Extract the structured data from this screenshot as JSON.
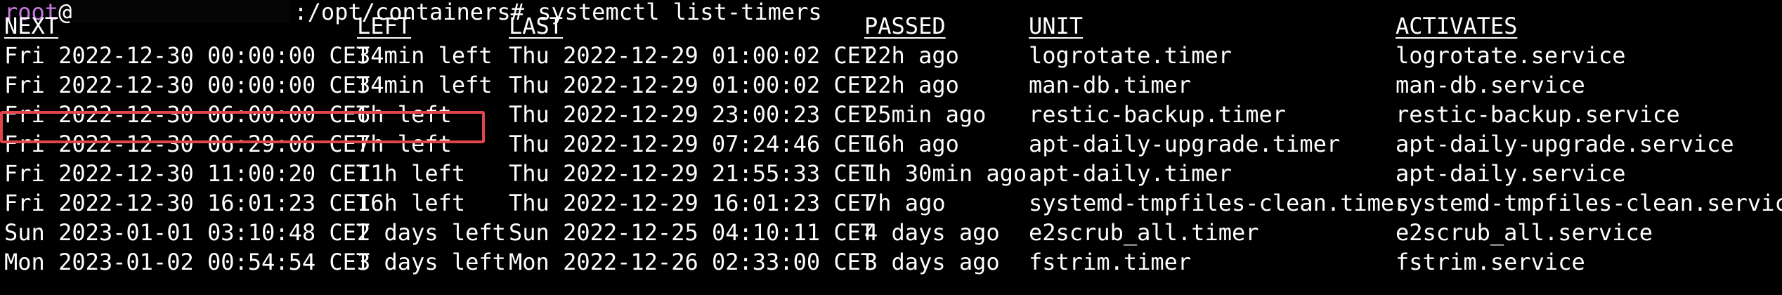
{
  "terminal": {
    "prompt": {
      "user": "root",
      "at": "@",
      "path_and_cmd": ":/opt/containers# systemctl list-timers"
    },
    "headers": {
      "next": "NEXT",
      "left": "LEFT",
      "last": "LAST",
      "passed": "PASSED",
      "unit": "UNIT",
      "activates": "ACTIVATES"
    },
    "rows": [
      {
        "next": "Fri 2022-12-30 00:00:00 CET",
        "left": "34min left",
        "last": "Thu 2022-12-29 01:00:02 CET",
        "passed": "22h ago",
        "unit": "logrotate.timer",
        "activates": "logrotate.service"
      },
      {
        "next": "Fri 2022-12-30 00:00:00 CET",
        "left": "34min left",
        "last": "Thu 2022-12-29 01:00:02 CET",
        "passed": "22h ago",
        "unit": "man-db.timer",
        "activates": "man-db.service"
      },
      {
        "next": "Fri 2022-12-30 06:00:00 CET",
        "left": "6h left",
        "last": "Thu 2022-12-29 23:00:23 CET",
        "passed": "25min ago",
        "unit": "restic-backup.timer",
        "activates": "restic-backup.service"
      },
      {
        "next": "Fri 2022-12-30 06:29:06 CET",
        "left": "7h left",
        "last": "Thu 2022-12-29 07:24:46 CET",
        "passed": "16h ago",
        "unit": "apt-daily-upgrade.timer",
        "activates": "apt-daily-upgrade.service"
      },
      {
        "next": "Fri 2022-12-30 11:00:20 CET",
        "left": "11h left",
        "last": "Thu 2022-12-29 21:55:33 CET",
        "passed": "1h 30min ago",
        "unit": "apt-daily.timer",
        "activates": "apt-daily.service"
      },
      {
        "next": "Fri 2022-12-30 16:01:23 CET",
        "left": "16h left",
        "last": "Thu 2022-12-29 16:01:23 CET",
        "passed": "7h ago",
        "unit": "systemd-tmpfiles-clean.timer",
        "activates": "systemd-tmpfiles-clean.service"
      },
      {
        "next": "Sun 2023-01-01 03:10:48 CET",
        "left": "2 days left",
        "last": "Sun 2022-12-25 04:10:11 CET",
        "passed": "4 days ago",
        "unit": "e2scrub_all.timer",
        "activates": "e2scrub_all.service"
      },
      {
        "next": "Mon 2023-01-02 00:54:54 CET",
        "left": "3 days left",
        "last": "Mon 2022-12-26 02:33:00 CET",
        "passed": "3 days ago",
        "unit": "fstrim.timer",
        "activates": "fstrim.service"
      }
    ],
    "highlight_color": "#e0454a",
    "prompt_user_color": "#c678dd",
    "background_color": "#000000"
  }
}
